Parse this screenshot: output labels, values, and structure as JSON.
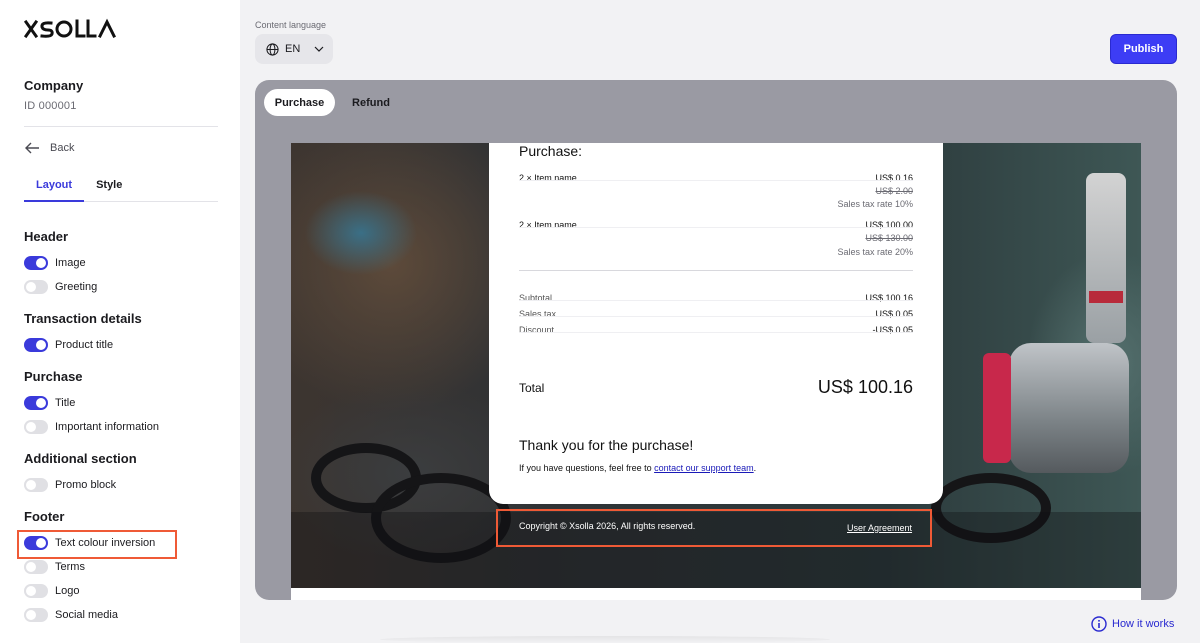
{
  "brand": {
    "logo_text": "XSOLLA",
    "accent": "#3a3adb",
    "publish_color": "#3d3df5",
    "highlight": "#ef5a36"
  },
  "sidebar": {
    "company": "Company",
    "company_id": "ID 000001",
    "back": "Back",
    "tabs": [
      {
        "label": "Layout",
        "active": true
      },
      {
        "label": "Style",
        "active": false
      }
    ],
    "sections": {
      "header": {
        "title": "Header",
        "items": [
          {
            "label": "Image",
            "on": true
          },
          {
            "label": "Greeting",
            "on": false
          }
        ]
      },
      "transaction": {
        "title": "Transaction details",
        "items": [
          {
            "label": "Product title",
            "on": true
          }
        ]
      },
      "purchase": {
        "title": "Purchase",
        "items": [
          {
            "label": "Title",
            "on": true
          },
          {
            "label": "Important information",
            "on": false
          }
        ]
      },
      "additional": {
        "title": "Additional section",
        "items": [
          {
            "label": "Promo block",
            "on": false
          }
        ]
      },
      "footer": {
        "title": "Footer",
        "items": [
          {
            "label": "Text colour inversion",
            "on": true
          },
          {
            "label": "Terms",
            "on": false
          },
          {
            "label": "Logo",
            "on": false
          },
          {
            "label": "Social media",
            "on": false
          }
        ]
      }
    }
  },
  "topbar": {
    "content_language_label": "Content language",
    "language": "EN",
    "publish": "Publish"
  },
  "preview": {
    "tabs": [
      {
        "label": "Purchase",
        "active": true
      },
      {
        "label": "Refund",
        "active": false
      }
    ],
    "receipt": {
      "title": "Purchase:",
      "items": [
        {
          "name": "2 × Item name",
          "price": "US$ 0.16",
          "old_price": "US$ 2.00",
          "tax": "Sales tax rate 10%"
        },
        {
          "name": "2 × Item name",
          "price": "US$ 100.00",
          "old_price": "US$ 130.00",
          "tax": "Sales tax rate 20%"
        }
      ],
      "summary": [
        {
          "label": "Subtotal",
          "value": "US$ 100.16"
        },
        {
          "label": "Sales tax",
          "value": "US$ 0.05"
        },
        {
          "label": "Discount",
          "value": "-US$ 0.05"
        }
      ],
      "total_label": "Total",
      "total_value": "US$ 100.16",
      "thanks": "Thank you for the purchase!",
      "question_prefix": "If you have questions, feel free to ",
      "support_link": "contact our support team",
      "question_suffix": "."
    },
    "footer": {
      "copyright": "Copyright © Xsolla 2026, All rights reserved.",
      "user_agreement": "User Agreement"
    }
  },
  "help": {
    "how_it_works": "How it works"
  }
}
